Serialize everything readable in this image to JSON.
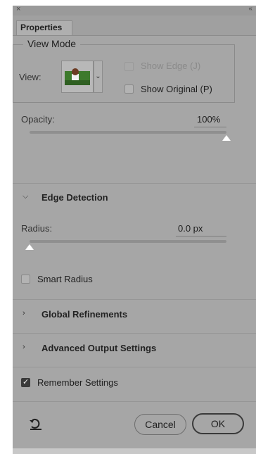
{
  "window": {
    "close_glyph": "×",
    "collapse_glyph": "‹‹"
  },
  "tab": {
    "label": "Properties"
  },
  "view_mode": {
    "legend": "View Mode",
    "view_label": "View:",
    "show_edge": {
      "label": "Show Edge (J)",
      "checked": false,
      "enabled": false
    },
    "show_original": {
      "label": "Show Original (P)",
      "checked": false,
      "enabled": true
    }
  },
  "opacity": {
    "label": "Opacity:",
    "value": "100%",
    "fraction": 1.0
  },
  "edge_detection": {
    "header": "Edge Detection",
    "radius_label": "Radius:",
    "radius_value": "0.0 px",
    "radius_fraction": 0.0,
    "smart_radius": {
      "label": "Smart Radius",
      "checked": false
    }
  },
  "global_refinements": {
    "header": "Global Refinements"
  },
  "advanced_output": {
    "header": "Advanced Output Settings"
  },
  "remember_settings": {
    "label": "Remember Settings",
    "checked": true
  },
  "buttons": {
    "cancel": "Cancel",
    "ok": "OK"
  },
  "icons": {
    "close": "close-icon",
    "collapse": "double-chevron-left-icon",
    "reset": "reset-icon",
    "chevron_down": "chevron-down-icon",
    "chevron_right": "chevron-right-icon"
  }
}
